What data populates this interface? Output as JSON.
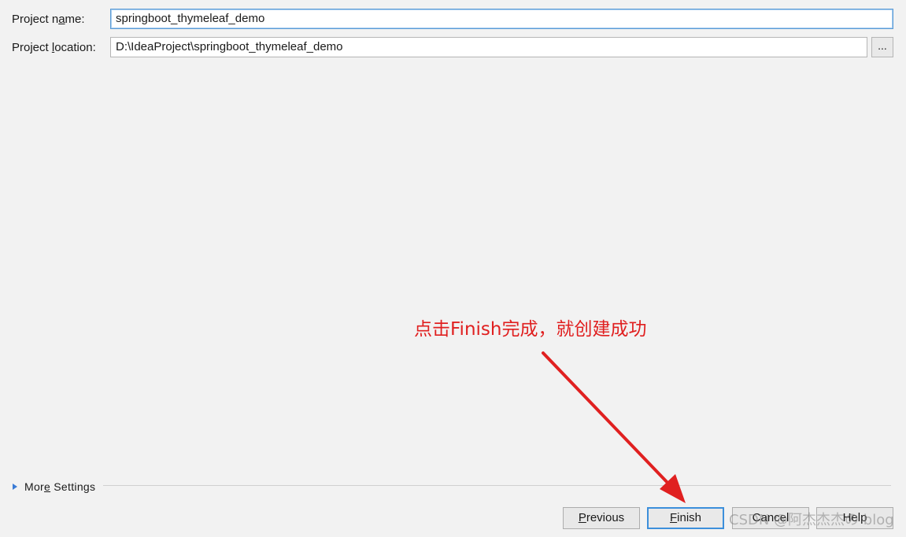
{
  "form": {
    "project_name": {
      "label_pre": "Project n",
      "label_mnemonic": "a",
      "label_post": "me:",
      "value": "springboot_thymeleaf_demo"
    },
    "project_location": {
      "label_pre": "Project ",
      "label_mnemonic": "l",
      "label_post": "ocation:",
      "value": "D:\\IdeaProject\\springboot_thymeleaf_demo",
      "browse_label": "..."
    }
  },
  "more_settings": {
    "label_pre": "Mor",
    "label_mnemonic": "e",
    "label_post": " Settings",
    "icon": "triangle-right-icon"
  },
  "buttons": {
    "previous": {
      "mnemonic": "P",
      "rest": "revious"
    },
    "finish": {
      "mnemonic": "F",
      "rest": "inish"
    },
    "cancel": {
      "label": "Cancel"
    },
    "help": {
      "label": "Help"
    }
  },
  "annotation": {
    "text": "点击Finish完成，就创建成功",
    "color": "#e02020"
  },
  "watermark": {
    "text": "CSDN @阿杰杰杰の blog"
  },
  "colors": {
    "background": "#f2f2f2",
    "focus_border": "#5b9bd5",
    "default_button_border": "#3c8fdb",
    "annotation_red": "#e02020"
  }
}
